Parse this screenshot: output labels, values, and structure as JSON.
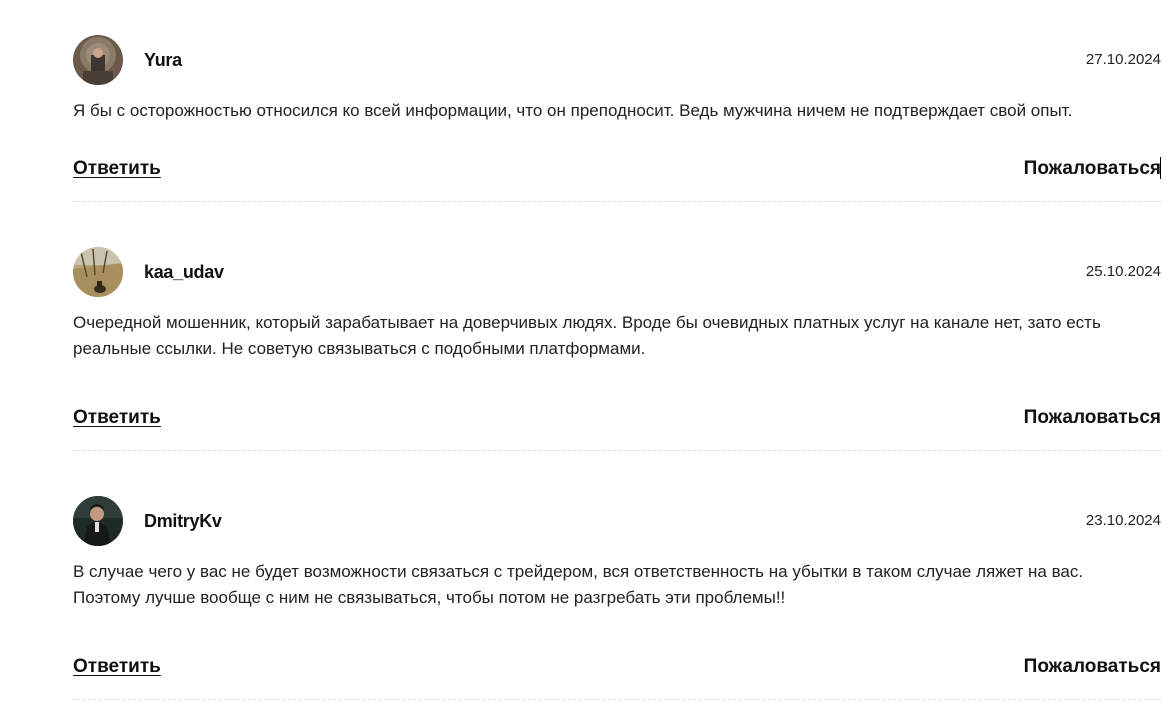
{
  "comments": [
    {
      "author": "Yura",
      "date": "27.10.2024",
      "text": "Я бы с осторожностью относился ко всей информации, что он преподносит. Ведь мужчина ничем не подтверждает свой опыт.",
      "reply_label": "Ответить",
      "report_label": "Пожаловаться"
    },
    {
      "author": "kaa_udav",
      "date": "25.10.2024",
      "text": "Очередной мошенник, который зарабатывает на доверчивых людях. Вроде бы очевидных платных услуг на канале нет, зато есть реальные ссылки. Не советую связываться с подобными платформами.",
      "reply_label": "Ответить",
      "report_label": "Пожаловаться"
    },
    {
      "author": "DmitryKv",
      "date": "23.10.2024",
      "text": "В случае чего у вас не будет возможности связаться с трейдером, вся ответственность на убытки в таком случае ляжет на вас. Поэтому лучше вообще с ним не связываться, чтобы потом не разгребать эти проблемы!!",
      "reply_label": "Ответить",
      "report_label": "Пожаловаться"
    }
  ]
}
